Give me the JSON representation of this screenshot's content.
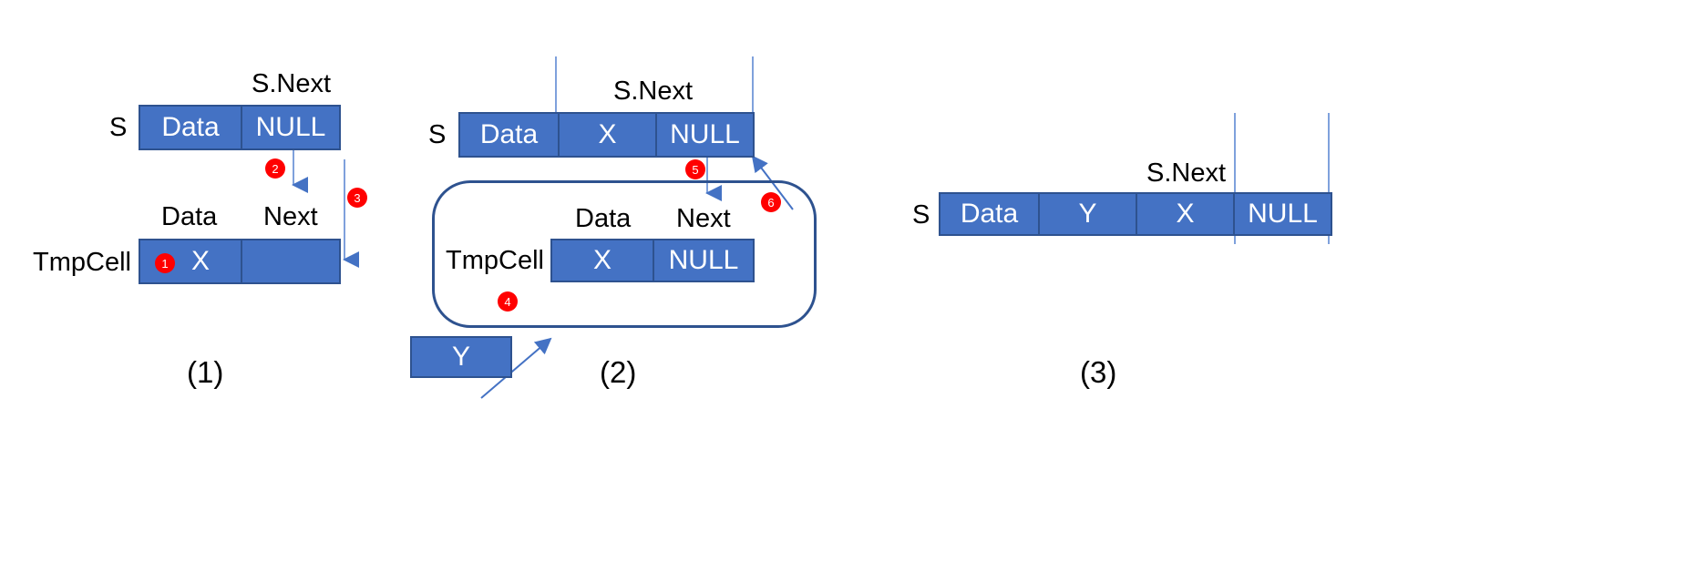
{
  "diagram": {
    "title": "Linked list insert-at-front sequence",
    "colors": {
      "cell_fill": "#4472C4",
      "cell_border": "#2E528F",
      "badge": "#FF0000",
      "arrow": "#4472C4",
      "bracket_line": "#7FA1DC",
      "text": "#000000",
      "cell_text": "#FFFFFF"
    }
  },
  "panel1": {
    "caption": "(1)",
    "s_label": "S",
    "s_next_label": "S.Next",
    "s_cells": [
      {
        "text": "Data"
      },
      {
        "text": "NULL"
      }
    ],
    "tmpcell_label": "TmpCell",
    "tmp_headers": [
      {
        "text": "Data"
      },
      {
        "text": "Next"
      }
    ],
    "tmp_cells": [
      {
        "text": "X"
      },
      {
        "text": ""
      }
    ],
    "badges": [
      {
        "n": "1"
      },
      {
        "n": "2"
      },
      {
        "n": "3"
      }
    ]
  },
  "panel2": {
    "caption": "(2)",
    "s_label": "S",
    "s_next_label": "S.Next",
    "s_cells": [
      {
        "text": "Data"
      },
      {
        "text": "X"
      },
      {
        "text": "NULL"
      }
    ],
    "tmpcell_label": "TmpCell",
    "tmp_headers": [
      {
        "text": "Data"
      },
      {
        "text": "Next"
      }
    ],
    "tmp_cells": [
      {
        "text": "X"
      },
      {
        "text": "NULL"
      }
    ],
    "new_node": {
      "text": "Y"
    },
    "badges": [
      {
        "n": "4"
      },
      {
        "n": "5"
      },
      {
        "n": "6"
      }
    ]
  },
  "panel3": {
    "caption": "(3)",
    "s_label": "S",
    "s_next_label": "S.Next",
    "s_cells": [
      {
        "text": "Data"
      },
      {
        "text": "Y"
      },
      {
        "text": "X"
      },
      {
        "text": "NULL"
      }
    ]
  }
}
